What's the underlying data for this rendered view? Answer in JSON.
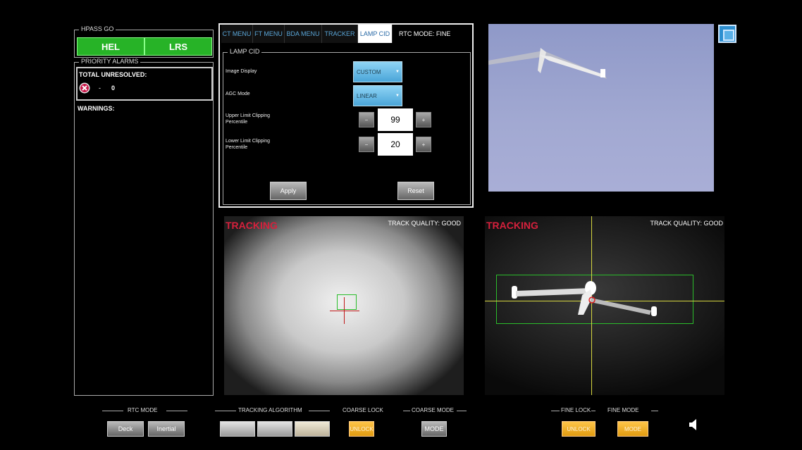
{
  "hpass": {
    "title": "HPASS GO",
    "hel_label": "HEL",
    "lrs_label": "LRS"
  },
  "alarms": {
    "title": "PRIORITY ALARMS",
    "total_label": "TOTAL UNRESOLVED:",
    "dash": "-",
    "count": "0",
    "warnings_label": "WARNINGS:"
  },
  "tabs": [
    {
      "label": "CT MENU"
    },
    {
      "label": "FT MENU"
    },
    {
      "label": "BDA MENU"
    },
    {
      "label": "TRACKER"
    },
    {
      "label": "LAMP CID"
    }
  ],
  "rtc_mode_status": "RTC MODE: FINE",
  "lamp": {
    "title": "LAMP CID",
    "image_display_label": "Image Display",
    "image_display_value": "CUSTOM",
    "agc_label": "AGC Mode",
    "agc_value": "LINEAR",
    "upper_label": "Upper Limit Clipping Percentile",
    "upper_value": "99",
    "lower_label": "Lower Limit Clipping Percentile",
    "lower_value": "20",
    "apply_label": "Apply",
    "reset_label": "Reset"
  },
  "views": {
    "left": {
      "status": "TRACKING",
      "quality": "TRACK QUALITY: GOOD"
    },
    "right": {
      "status": "TRACKING",
      "quality": "TRACK QUALITY: GOOD"
    }
  },
  "bottom": {
    "rtc_mode_label": "RTC MODE",
    "deck_label": "Deck",
    "inertial_label": "Inertial",
    "tracking_algorithm_label": "TRACKING ALGORITHM",
    "coarse_lock_label": "COARSE LOCK",
    "coarse_unlock_label": "UNLOCK",
    "coarse_mode_label": "COARSE MODE",
    "coarse_mode_btn": "MODE",
    "fine_lock_label": "FINE LOCK",
    "fine_unlock_label": "UNLOCK",
    "fine_mode_label": "FINE MODE",
    "fine_mode_btn": "MODE"
  },
  "colors": {
    "green": "#27b327",
    "orange": "#f0a820",
    "tracking_red": "#d6203c",
    "sky": "#9aa3cc"
  },
  "icons": {
    "error": "x-circle-icon",
    "speaker": "speaker-icon",
    "window": "window-icon"
  }
}
